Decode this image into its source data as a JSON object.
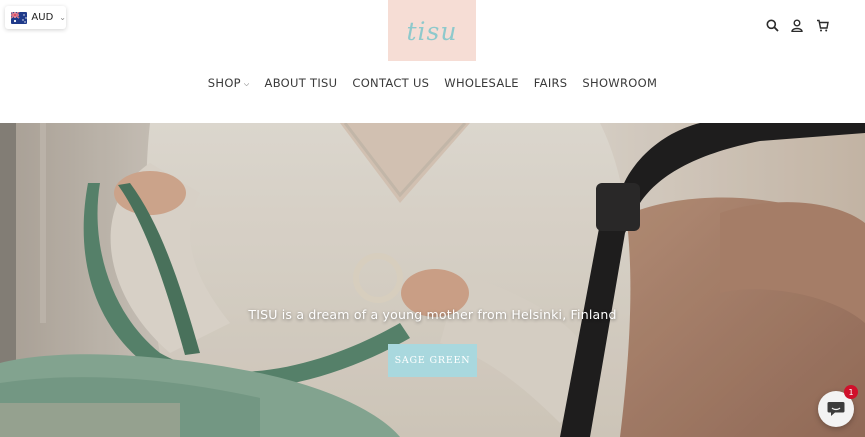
{
  "currency": {
    "code": "AUD",
    "flag_icon": "australia-flag-icon"
  },
  "logo": {
    "text": "tisu",
    "bg_color": "#f6ddd5",
    "text_color": "#8ec9cc"
  },
  "header_icons": [
    "search-icon",
    "account-icon",
    "cart-icon"
  ],
  "nav": {
    "items": [
      {
        "label": "SHOP",
        "has_dropdown": true
      },
      {
        "label": "ABOUT TISU"
      },
      {
        "label": "CONTACT US"
      },
      {
        "label": "WHOLESALE"
      },
      {
        "label": "FAIRS"
      },
      {
        "label": "SHOWROOM"
      }
    ]
  },
  "hero": {
    "tagline": "TISU is a dream of a young mother from Helsinki, Finland",
    "cta_label": "SAGE GREEN",
    "cta_color": "#a9d8de"
  },
  "chat": {
    "badge_count": "1"
  }
}
